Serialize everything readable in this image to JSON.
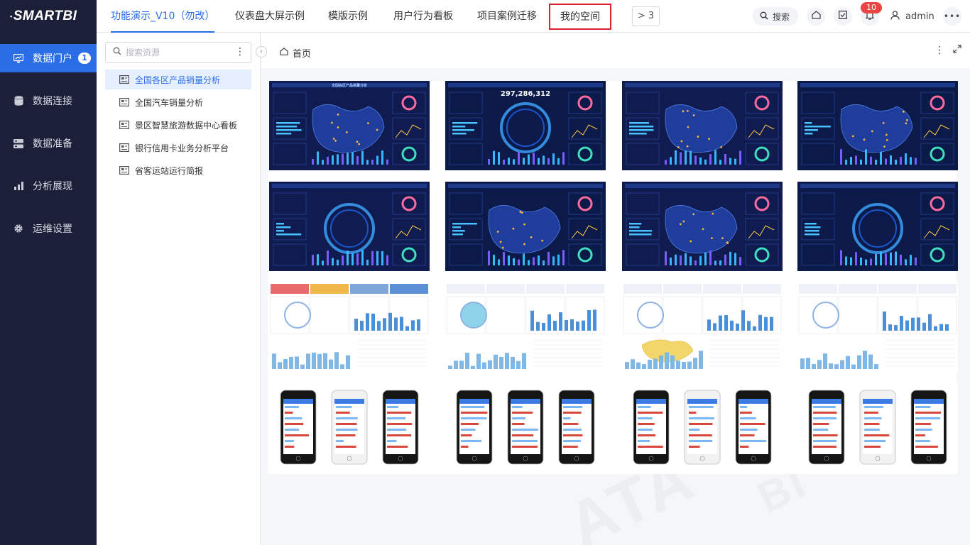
{
  "app": {
    "logo": "SMARTBI"
  },
  "sidebar": {
    "items": [
      {
        "label": "数据门户",
        "icon": "monitor-icon",
        "badge": "1",
        "active": true
      },
      {
        "label": "数据连接",
        "icon": "database-icon"
      },
      {
        "label": "数据准备",
        "icon": "server-icon"
      },
      {
        "label": "分析展现",
        "icon": "bar-chart-icon"
      },
      {
        "label": "运维设置",
        "icon": "gear-icon"
      }
    ]
  },
  "tabs": [
    {
      "label": "功能演示_V10（勿改）",
      "active": true
    },
    {
      "label": "仪表盘大屏示例"
    },
    {
      "label": "模版示例"
    },
    {
      "label": "用户行为看板"
    },
    {
      "label": "项目案例迁移"
    },
    {
      "label": "我的空间",
      "highlighted": true
    }
  ],
  "more_tabs": {
    "label": "3"
  },
  "header": {
    "search_label": "搜索",
    "notification_count": "10",
    "user": "admin"
  },
  "resource_panel": {
    "search_placeholder": "搜索资源",
    "items": [
      {
        "label": "全国各区产品销量分析",
        "active": true
      },
      {
        "label": "全国汽车销量分析"
      },
      {
        "label": "景区智慧旅游数据中心看板"
      },
      {
        "label": "银行信用卡业务分析平台"
      },
      {
        "label": "省客运站运行简报"
      }
    ]
  },
  "breadcrumb": {
    "home_label": "首页"
  },
  "main": {
    "thumbnails": [
      {
        "kind": "dark-dashboard",
        "title": "全国各区产品销量分析"
      },
      {
        "kind": "dark-dashboard",
        "title": "297,286,312"
      },
      {
        "kind": "dark-dashboard",
        "title": ""
      },
      {
        "kind": "dark-dashboard",
        "title": ""
      },
      {
        "kind": "dark-dashboard",
        "title": ""
      },
      {
        "kind": "dark-dashboard",
        "title": ""
      },
      {
        "kind": "dark-dashboard",
        "title": ""
      },
      {
        "kind": "dark-dashboard",
        "title": ""
      },
      {
        "kind": "light-report",
        "title": ""
      },
      {
        "kind": "light-report",
        "title": ""
      },
      {
        "kind": "light-report",
        "title": ""
      },
      {
        "kind": "light-report",
        "title": ""
      },
      {
        "kind": "mobile-preview",
        "title": ""
      },
      {
        "kind": "mobile-preview",
        "title": ""
      },
      {
        "kind": "mobile-preview",
        "title": ""
      },
      {
        "kind": "mobile-preview",
        "title": ""
      }
    ]
  },
  "colors": {
    "sidebar_bg": "#1b2038",
    "accent": "#2b6de5",
    "highlight_border": "#d9232d",
    "badge_red": "#e94545"
  }
}
